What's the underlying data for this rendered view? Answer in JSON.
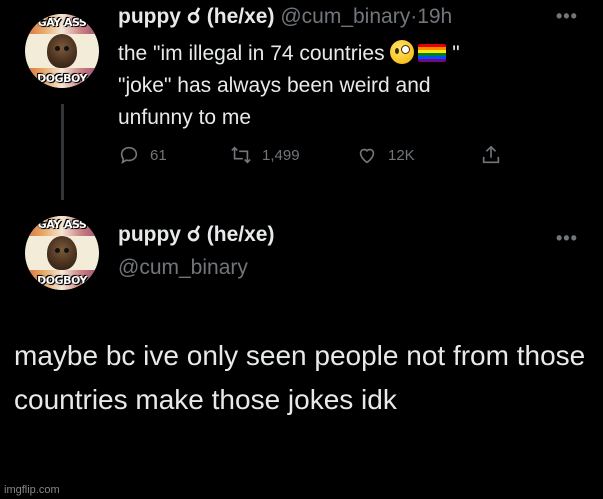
{
  "tweet1": {
    "avatar": {
      "top_label": "GAY ASS",
      "bottom_label": "DOGBOY"
    },
    "display_name": "puppy",
    "pronoun_symbol": "☌",
    "pronouns": "(he/xe)",
    "handle": "@cum_binary",
    "separator": "·",
    "time": "19h",
    "text_line1": "the \"im illegal in 74 countries",
    "text_quote_end": "\"",
    "text_line2": "\"joke\" has always been weird and",
    "text_line3": "unfunny to me",
    "emoji": [
      "zany-face",
      "rainbow-flag"
    ],
    "actions": {
      "replies": "61",
      "retweets": "1,499",
      "likes": "12K"
    },
    "more_icon": "•••"
  },
  "tweet2": {
    "avatar": {
      "top_label": "GAY ASS",
      "bottom_label": "DOGBOY"
    },
    "display_name": "puppy",
    "pronoun_symbol": "☌",
    "pronouns": "(he/xe)",
    "handle": "@cum_binary",
    "more_icon": "•••",
    "body": "maybe bc ive only seen people not from those countries make those jokes idk"
  },
  "watermark": "imgflip.com",
  "colors": {
    "background": "#000000",
    "text": "#e7e9ea",
    "muted": "#71767b",
    "thread_line": "#333639"
  }
}
